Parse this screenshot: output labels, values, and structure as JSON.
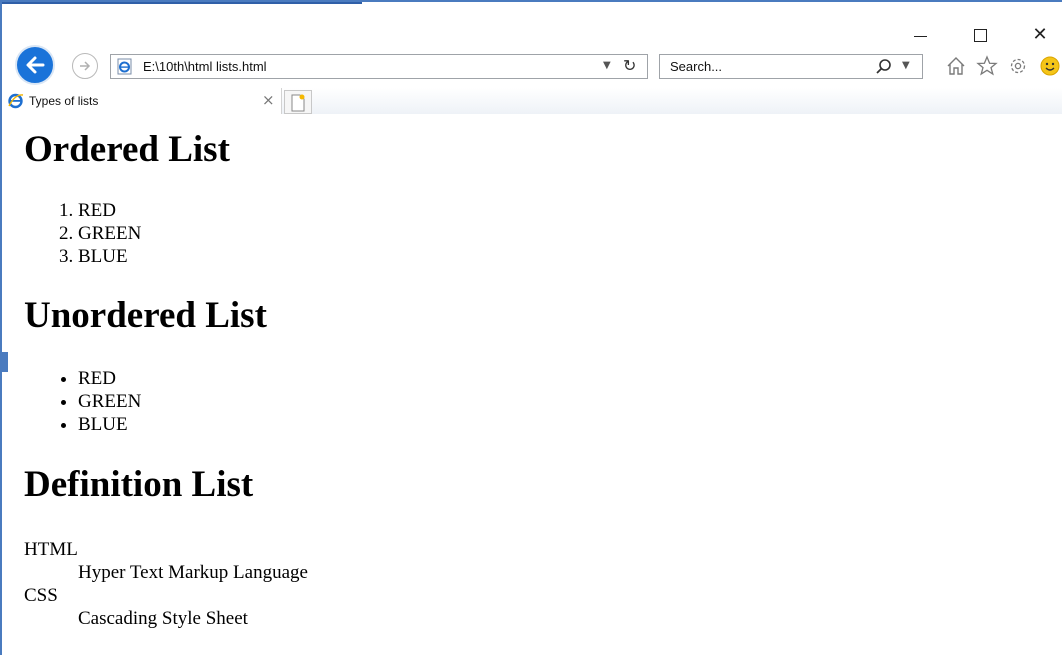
{
  "browser": {
    "address": "E:\\10th\\html lists.html",
    "search_placeholder": "Search...",
    "tab_title": "Types of lists",
    "tab_close": "×",
    "window_controls": {
      "minimize": "",
      "maximize": "",
      "close": "✕"
    },
    "icons": [
      "back-arrow-icon",
      "forward-arrow-icon",
      "ie-page-icon",
      "refresh-icon",
      "search-icon",
      "home-icon",
      "favorites-star-icon",
      "settings-gear-icon",
      "smiley-feedback-icon",
      "new-tab-icon"
    ],
    "accent_color": "#1a73d9"
  },
  "page": {
    "ordered": {
      "heading": "Ordered List",
      "items": [
        "RED",
        "GREEN",
        "BLUE"
      ]
    },
    "unordered": {
      "heading": "Unordered List",
      "items": [
        "RED",
        "GREEN",
        "BLUE"
      ]
    },
    "definition": {
      "heading": "Definition List",
      "entries": [
        {
          "term": "HTML",
          "definition": "Hyper Text Markup Language"
        },
        {
          "term": "CSS",
          "definition": "Cascading Style Sheet"
        }
      ]
    }
  }
}
